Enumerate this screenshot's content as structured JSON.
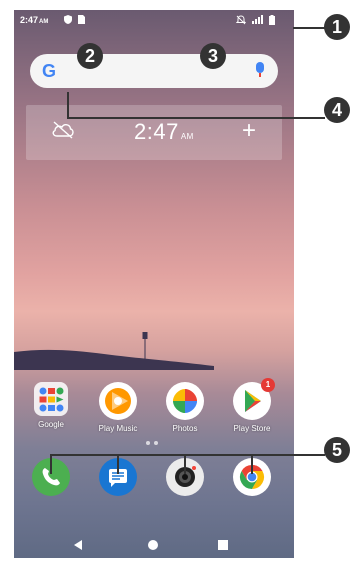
{
  "status_bar": {
    "time": "2:47",
    "ampm": "AM"
  },
  "search": {
    "logo": "G",
    "mic_icon": "mic-icon"
  },
  "clock_widget": {
    "time": "2:47",
    "ampm": "AM",
    "left_icon": "cloud-off-icon",
    "right_icon": "plus-icon"
  },
  "apps": [
    {
      "label": "Google",
      "icon": "google-folder-icon"
    },
    {
      "label": "Play Music",
      "icon": "play-music-icon"
    },
    {
      "label": "Photos",
      "icon": "photos-icon"
    },
    {
      "label": "Play Store",
      "icon": "play-store-icon",
      "badge": "1"
    }
  ],
  "dock": [
    {
      "icon": "phone-icon"
    },
    {
      "icon": "messages-icon"
    },
    {
      "icon": "camera-icon"
    },
    {
      "icon": "chrome-icon"
    }
  ],
  "nav": {
    "back": "back-icon",
    "home": "home-icon",
    "recents": "recents-icon"
  },
  "callouts": [
    "1",
    "2",
    "3",
    "4",
    "5"
  ],
  "colors": {
    "callout": "#333333",
    "search_bar": "#f5f5f5",
    "accent_blue": "#4285f4"
  }
}
